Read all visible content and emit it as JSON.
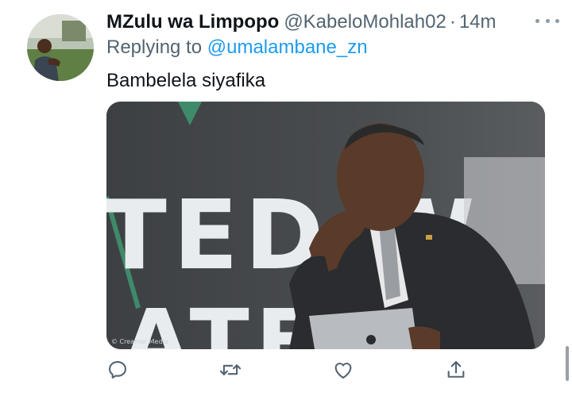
{
  "tweet": {
    "display_name": "MZulu wa Limpopo",
    "handle": "@KabeloMohlah02",
    "separator": "·",
    "timestamp": "14m",
    "replying_prefix": "Replying to",
    "replying_to": "@umalambane_zn",
    "text": "Bambelela siyafika"
  },
  "media": {
    "watermark": "© Creamer Media",
    "backdrop_text": "TED W",
    "backdrop_text_2": "ATE"
  },
  "actions": [
    {
      "name": "reply",
      "icon": "comment-icon"
    },
    {
      "name": "retweet",
      "icon": "retweet-icon"
    },
    {
      "name": "like",
      "icon": "heart-icon"
    },
    {
      "name": "share",
      "icon": "share-icon"
    }
  ],
  "colors": {
    "link": "#1d9bf0",
    "secondary_text": "#536471",
    "icon": "#536471"
  }
}
